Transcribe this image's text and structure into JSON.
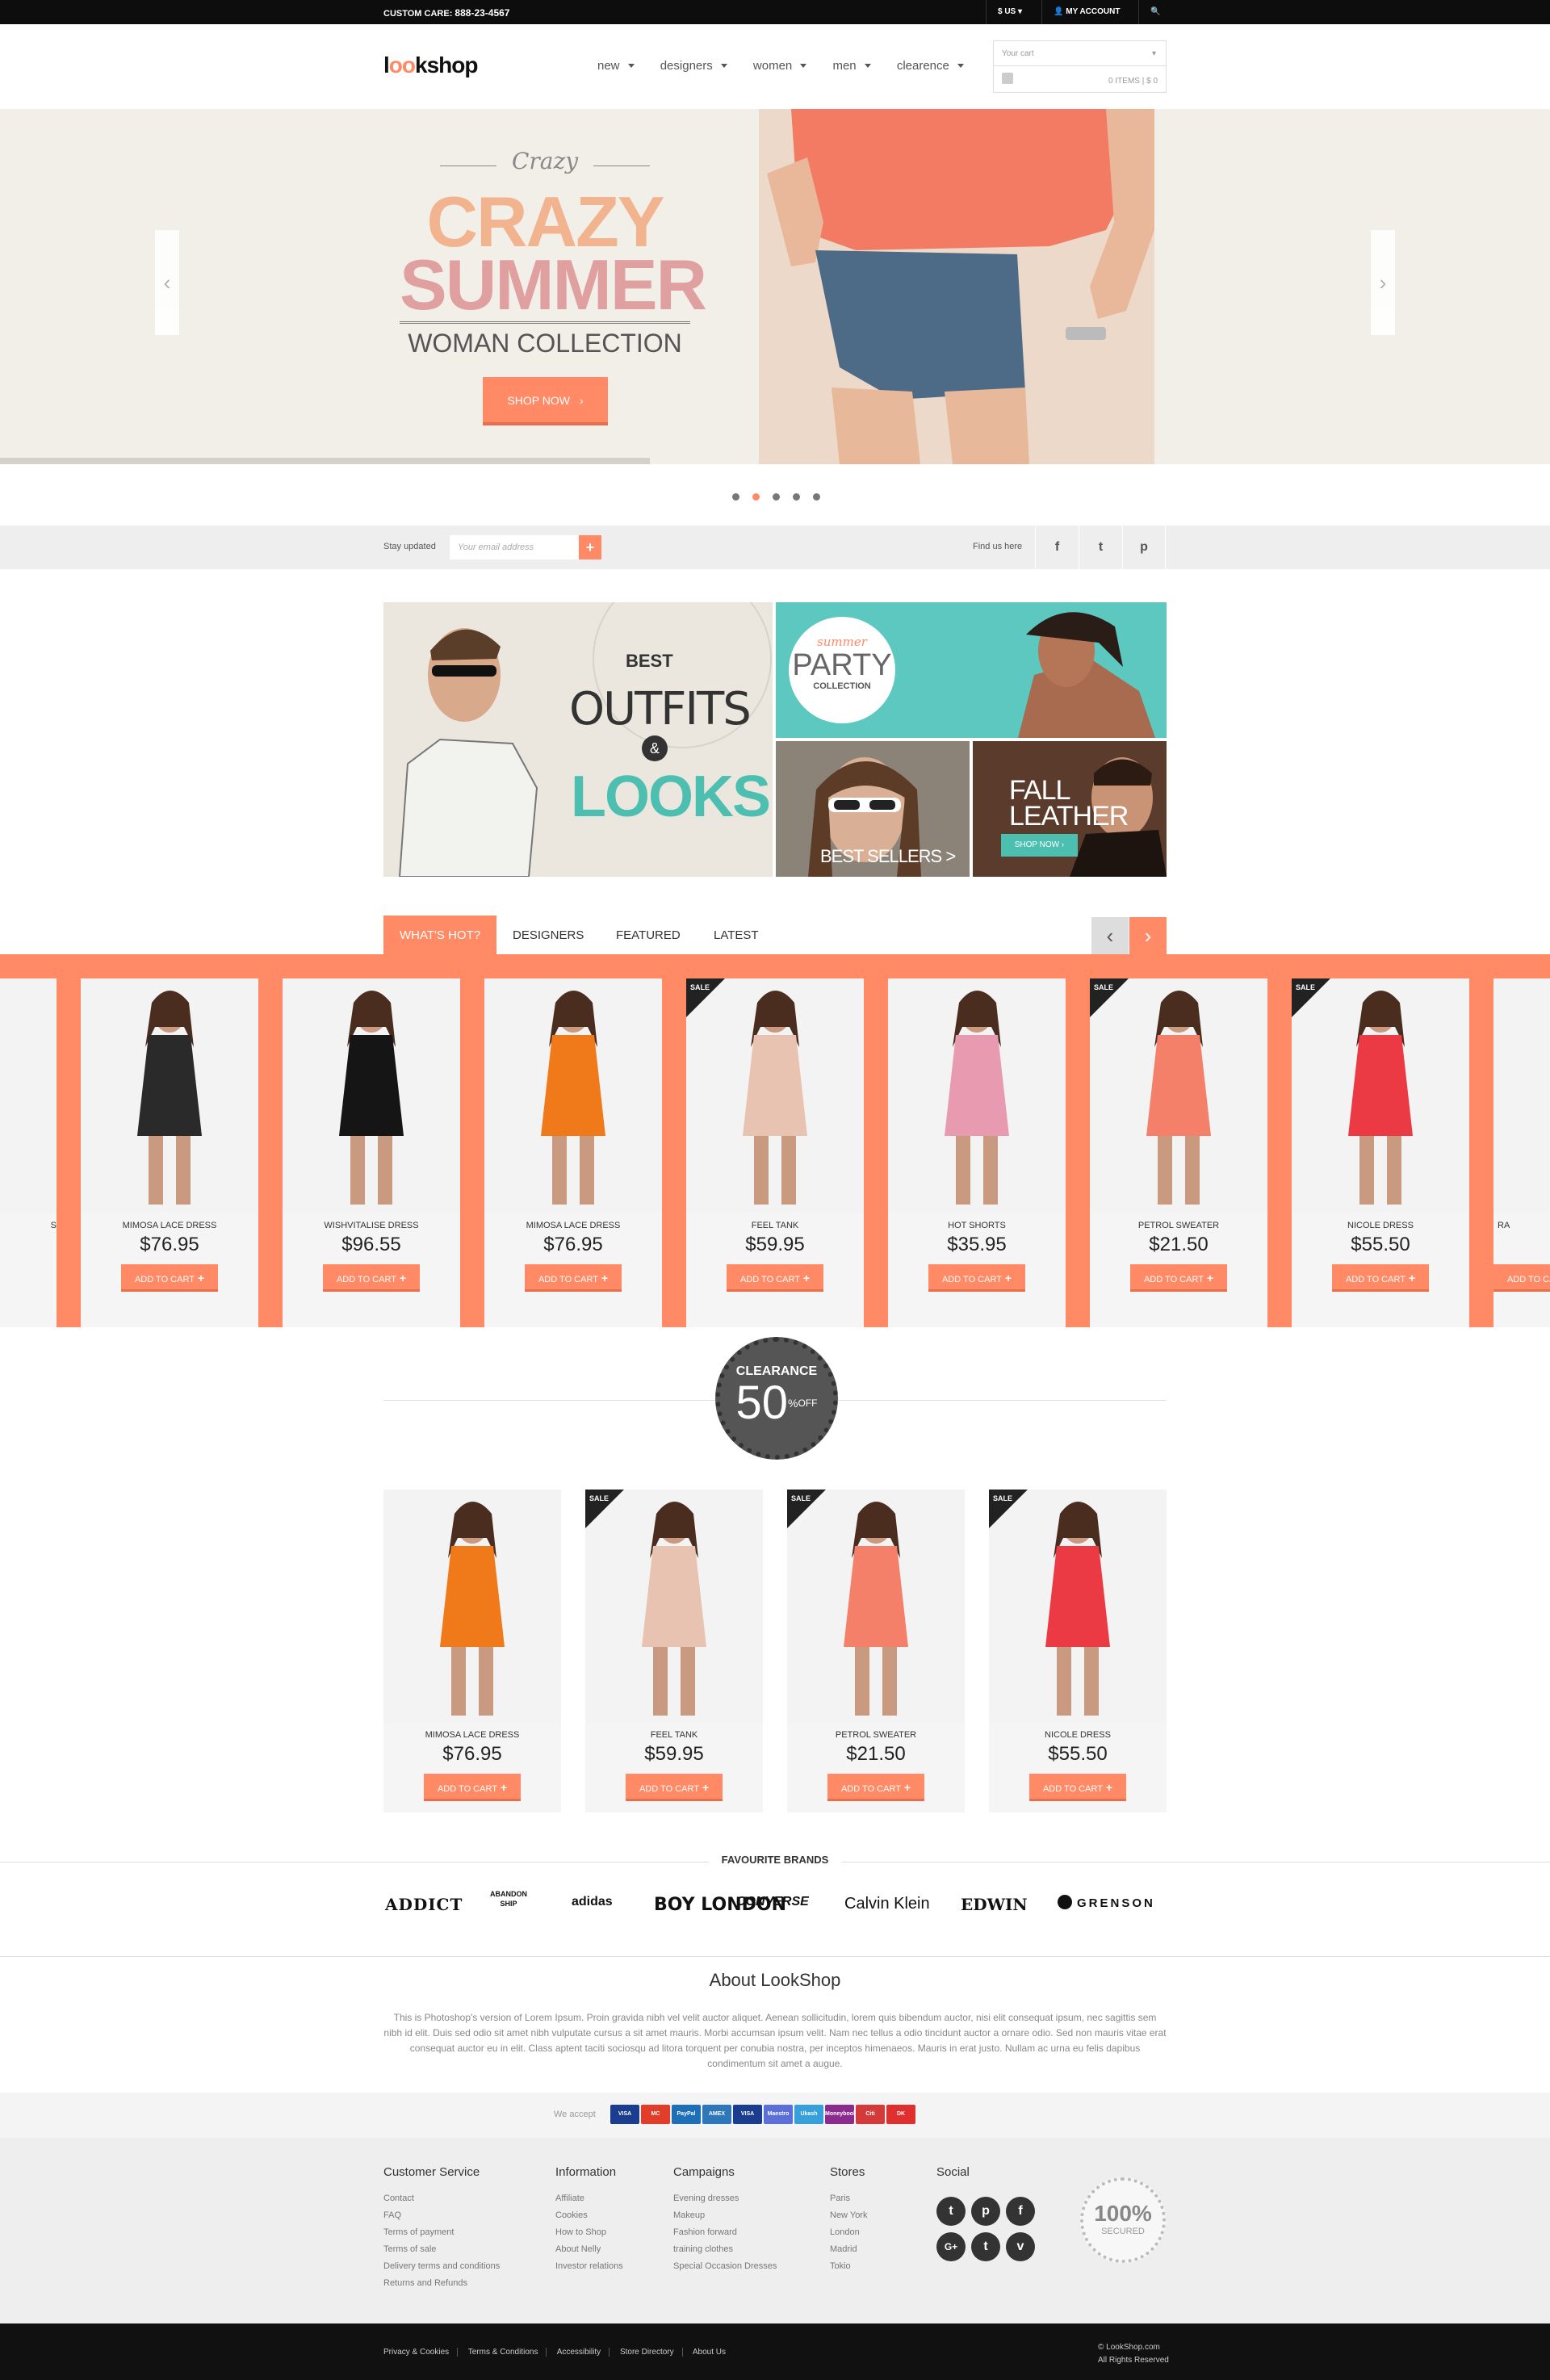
{
  "topbar": {
    "custom_care_label": "CUSTOM CARE:",
    "phone": "888-23-4567",
    "currency": "$ US",
    "my_account": "MY ACCOUNT"
  },
  "brand": {
    "logo_prefix": "l",
    "logo_oo": "oo",
    "logo_suffix": "kshop"
  },
  "nav": [
    "new",
    "designers",
    "women",
    "men",
    "clearence"
  ],
  "cart": {
    "title": "Your cart",
    "summary": "0 ITEMS | $ 0"
  },
  "hero": {
    "script": "Crazy",
    "title_line1": "CRAZY",
    "title_line2": "SUMMER",
    "subtitle": "WOMAN COLLECTION",
    "cta": "SHOP NOW",
    "slides_count": 5,
    "active_slide": 2
  },
  "newsletter": {
    "label": "Stay updated",
    "placeholder": "Your email address",
    "submit": "+",
    "find_us": "Find us here",
    "social": [
      "f",
      "t",
      "p"
    ]
  },
  "promo": {
    "big": {
      "best": "BEST",
      "outfits": "OUTFITS",
      "amp": "&",
      "looks": "LOOKS"
    },
    "party": {
      "script": "summer",
      "title": "PARTY",
      "sub": "COLLECTION"
    },
    "bestsellers": "BEST SELLERS >",
    "leather": {
      "line1": "FALL",
      "line2": "LEATHER",
      "cta": "SHOP NOW"
    }
  },
  "tabs": [
    {
      "label": "WHAT'S HOT?",
      "active": true
    },
    {
      "label": "DESIGNERS",
      "active": false
    },
    {
      "label": "FEATURED",
      "active": false
    },
    {
      "label": "LATEST",
      "active": false
    }
  ],
  "carousel_arrows": {
    "prev": "‹",
    "next": "›"
  },
  "hot_products": [
    {
      "name": "S",
      "price": "",
      "sale": false,
      "color": "#6b6b6b",
      "partial": "left"
    },
    {
      "name": "MIMOSA LACE DRESS",
      "price": "$76.95",
      "sale": false,
      "color": "#2a2a2a"
    },
    {
      "name": "WISHVITALISE DRESS",
      "price": "$96.55",
      "sale": false,
      "color": "#151515"
    },
    {
      "name": "MIMOSA LACE DRESS",
      "price": "$76.95",
      "sale": false,
      "color": "#f07a1a"
    },
    {
      "name": "FEEL TANK",
      "price": "$59.95",
      "sale": true,
      "color": "#e9c3b1"
    },
    {
      "name": "HOT SHORTS",
      "price": "$35.95",
      "sale": false,
      "color": "#e79ab0"
    },
    {
      "name": "PETROL SWEATER",
      "price": "$21.50",
      "sale": true,
      "color": "#f4806a"
    },
    {
      "name": "NICOLE DRESS",
      "price": "$55.50",
      "sale": true,
      "color": "#ec3a45"
    },
    {
      "name": "RA",
      "price": "",
      "sale": false,
      "color": "#45596b",
      "partial": "right"
    }
  ],
  "add_to_cart": "ADD TO CART",
  "sale_label": "SALE",
  "clearance": {
    "title": "CLEARANCE",
    "percent": "50",
    "pct": "%",
    "off": "OFF"
  },
  "clearance_products": [
    {
      "name": "MIMOSA LACE DRESS",
      "price": "$76.95",
      "sale": false,
      "color": "#f07a1a"
    },
    {
      "name": "FEEL TANK",
      "price": "$59.95",
      "sale": true,
      "color": "#e9c3b1"
    },
    {
      "name": "PETROL SWEATER",
      "price": "$21.50",
      "sale": true,
      "color": "#f4806a"
    },
    {
      "name": "NICOLE DRESS",
      "price": "$55.50",
      "sale": true,
      "color": "#ec3a45"
    }
  ],
  "brands": {
    "title": "FAVOURITE BRANDS",
    "items": [
      "ADDICT",
      "ABANDON SHIP",
      "adidas",
      "BOY LONDON",
      "CONVERSE",
      "Calvin Klein",
      "EDWIN",
      "GRENSON"
    ]
  },
  "about": {
    "title": "About LookShop",
    "text": "This is Photoshop's version of Lorem Ipsum. Proin gravida nibh vel velit auctor aliquet. Aenean sollicitudin, lorem quis bibendum auctor, nisi elit consequat ipsum, nec sagittis sem nibh id elit. Duis sed odio sit amet nibh vulputate cursus a sit amet mauris. Morbi accumsan ipsum velit. Nam nec tellus a odio tincidunt auctor a ornare odio. Sed non mauris vitae erat consequat auctor eu in elit. Class aptent taciti sociosqu ad litora torquent per conubia nostra, per inceptos himenaeos. Mauris in erat justo. Nullam ac urna eu felis dapibus condimentum sit amet a augue."
  },
  "payment": {
    "label": "We accept",
    "cards": [
      {
        "name": "VISA",
        "color": "#1a3d8f"
      },
      {
        "name": "MC",
        "color": "#e23d28"
      },
      {
        "name": "PayPal",
        "color": "#1d6fb8"
      },
      {
        "name": "AMEX",
        "color": "#2e77bb"
      },
      {
        "name": "VISA",
        "color": "#1a3d8f"
      },
      {
        "name": "Maestro",
        "color": "#5b6fd8"
      },
      {
        "name": "Ukash",
        "color": "#37a0db"
      },
      {
        "name": "Moneybookers",
        "color": "#8b2a8f"
      },
      {
        "name": "Citi",
        "color": "#d53a3a"
      },
      {
        "name": "DK",
        "color": "#e02f2f"
      }
    ]
  },
  "footer": {
    "columns": [
      {
        "title": "Customer Service",
        "links": [
          "Contact",
          "FAQ",
          "Terms of payment",
          "Terms of sale",
          "Delivery terms and conditions",
          "Returns and Refunds"
        ]
      },
      {
        "title": "Information",
        "links": [
          "Affiliate",
          "Cookies",
          "How to Shop",
          "About Nelly",
          "Investor relations"
        ]
      },
      {
        "title": "Campaigns",
        "links": [
          "Evening dresses",
          "Makeup",
          "Fashion forward",
          "training clothes",
          "Special Occasion Dresses"
        ]
      },
      {
        "title": "Stores",
        "links": [
          "Paris",
          "New York",
          "London",
          "Madrid",
          "Tokio"
        ]
      }
    ],
    "social_title": "Social",
    "social": [
      "t",
      "p",
      "f",
      "G+",
      "t",
      "v"
    ],
    "secured": {
      "big": "100%",
      "small": "SECURED"
    },
    "bottom_links": [
      "Privacy & Cookies",
      "Terms & Conditions",
      "Accessibility",
      "Store Directory",
      "About Us"
    ],
    "copyright": "© LookShop.com",
    "rights": "All Rights Reserved"
  }
}
